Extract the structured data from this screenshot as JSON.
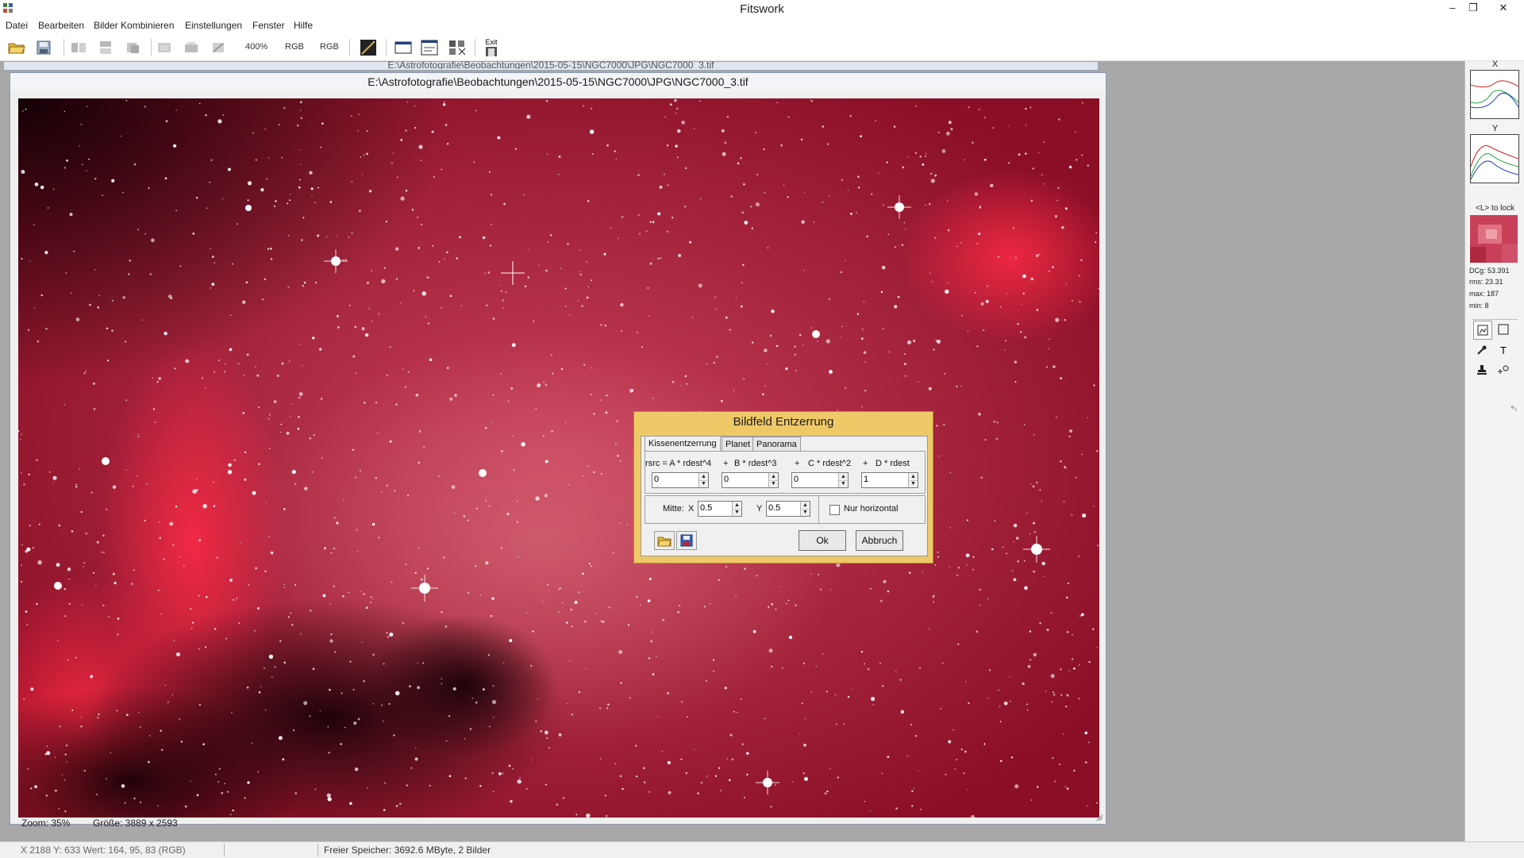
{
  "app": {
    "title": "Fitswork"
  },
  "window_controls": {
    "minimize": "–",
    "restore": "❐",
    "close": "✕"
  },
  "menu": [
    "Datei",
    "Bearbeiten",
    "Bilder Kombinieren",
    "Einstellungen",
    "Fenster",
    "Hilfe"
  ],
  "toolbar": {
    "zoom": "400%",
    "rgb1": "RGB",
    "rgb2": "RGB",
    "exit": "Exit"
  },
  "image_window": {
    "back_title": "E:\\Astrofotografie\\Beobachtungen\\2015-05-15\\NGC7000\\JPG\\NGC7000_3.tif",
    "title": "E:\\Astrofotografie\\Beobachtungen\\2015-05-15\\NGC7000\\JPG\\NGC7000_3.tif",
    "zoom": "Zoom: 35%",
    "size": "Größe: 3889 x 2593"
  },
  "right_panel": {
    "x_label": "X",
    "y_label": "Y",
    "lock_hint": "<L> to lock",
    "stats": {
      "dcg": "DCg: 53.391",
      "rms": "rms: 23.31",
      "max": "max: 187",
      "min": "min: 8"
    }
  },
  "dialog": {
    "title": "Bildfeld Entzerrung",
    "tabs": [
      "Kissenentzerrung",
      "Planet",
      "Panorama"
    ],
    "coefficients": {
      "a_label": "rsrc = A * rdest^4",
      "b_label": "B * rdest^3",
      "c_label": "C * rdest^2",
      "d_label": "D * rdest",
      "plus": "+",
      "a_value": "0",
      "b_value": "0",
      "c_value": "0",
      "d_value": "1"
    },
    "center": {
      "label": "Mitte:",
      "x_label": "X",
      "x_value": "0.5",
      "y_label": "Y",
      "y_value": "0.5"
    },
    "only_horizontal_label": "Nur horizontal",
    "only_horizontal_checked": false,
    "ok_label": "Ok",
    "cancel_label": "Abbruch"
  },
  "status": {
    "coords": "X 2188 Y: 633 Wert: 164, 95, 83 (RGB)",
    "memory": "Freier Speicher: 3692.6 MByte, 2 Bilder"
  },
  "colors": {
    "dialog_bg": "#efc968",
    "nebula_red": "#b01432"
  }
}
